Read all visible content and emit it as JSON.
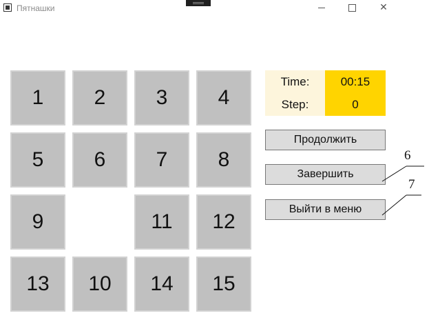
{
  "window": {
    "title": "Пятнашки",
    "icons": [
      "app-icon",
      "minimize-icon",
      "maximize-icon",
      "close-icon"
    ]
  },
  "board": {
    "tiles": [
      "1",
      "2",
      "3",
      "4",
      "5",
      "6",
      "7",
      "8",
      "9",
      "",
      "11",
      "12",
      "13",
      "10",
      "14",
      "15"
    ]
  },
  "info": {
    "time_label": "Time:",
    "time_value": "00:15",
    "step_label": "Step:",
    "step_value": "0",
    "colors": {
      "label_bg": "#fdf5dc",
      "value_bg": "#ffd400"
    }
  },
  "buttons": {
    "continue": "Продолжить",
    "finish": "Завершить",
    "exit_menu": "Выйти в меню"
  },
  "callouts": {
    "finish_number": "6",
    "exit_number": "7"
  },
  "colors": {
    "tile_bg": "#c0c0c0",
    "button_bg": "#dcdcdc"
  }
}
